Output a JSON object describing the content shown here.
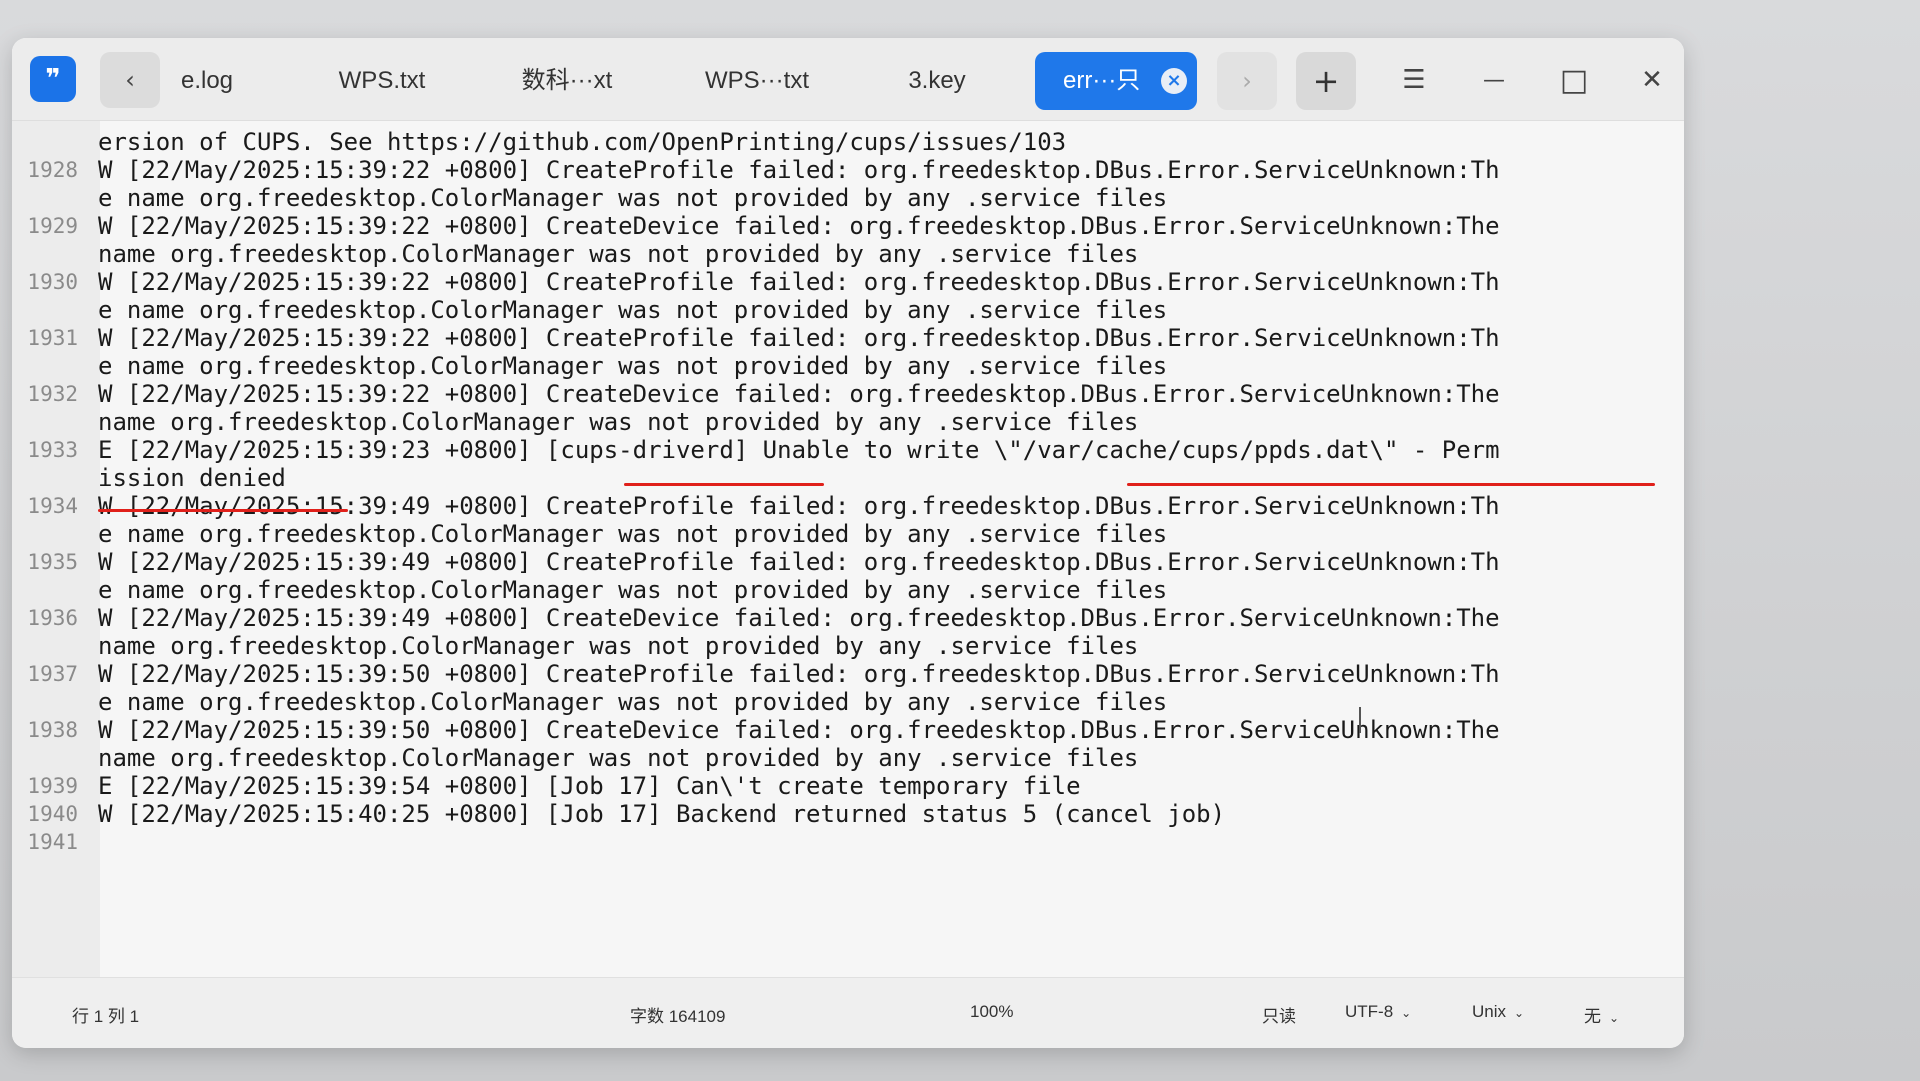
{
  "tabs": [
    {
      "label": "e.log"
    },
    {
      "label": "WPS.txt"
    },
    {
      "label": "数科···xt"
    },
    {
      "label": "WPS···txt"
    },
    {
      "label": "3.key"
    },
    {
      "label": "err···只",
      "active": true
    }
  ],
  "titlebar": {
    "app_icon": "quote-icon",
    "back_glyph": "‹",
    "forward_glyph": "›",
    "add_glyph": "+",
    "menu_glyph": "☰",
    "minimize_glyph": "—",
    "maximize_glyph": "□",
    "close_glyph": "✕",
    "tab_close_glyph": "×"
  },
  "editor": {
    "lines": [
      {
        "num": "",
        "text": "ersion of CUPS. See https://github.com/OpenPrinting/cups/issues/103"
      },
      {
        "num": "1928",
        "text": "W [22/May/2025:15:39:22 +0800] CreateProfile failed: org.freedesktop.DBus.Error.ServiceUnknown:Th"
      },
      {
        "num": "",
        "text": "e name org.freedesktop.ColorManager was not provided by any .service files"
      },
      {
        "num": "1929",
        "text": "W [22/May/2025:15:39:22 +0800] CreateDevice failed: org.freedesktop.DBus.Error.ServiceUnknown:The"
      },
      {
        "num": "",
        "text": "name org.freedesktop.ColorManager was not provided by any .service files"
      },
      {
        "num": "1930",
        "text": "W [22/May/2025:15:39:22 +0800] CreateProfile failed: org.freedesktop.DBus.Error.ServiceUnknown:Th"
      },
      {
        "num": "",
        "text": "e name org.freedesktop.ColorManager was not provided by any .service files"
      },
      {
        "num": "1931",
        "text": "W [22/May/2025:15:39:22 +0800] CreateProfile failed: org.freedesktop.DBus.Error.ServiceUnknown:Th"
      },
      {
        "num": "",
        "text": "e name org.freedesktop.ColorManager was not provided by any .service files"
      },
      {
        "num": "1932",
        "text": "W [22/May/2025:15:39:22 +0800] CreateDevice failed: org.freedesktop.DBus.Error.ServiceUnknown:The"
      },
      {
        "num": "",
        "text": "name org.freedesktop.ColorManager was not provided by any .service files"
      },
      {
        "num": "1933",
        "text": "E [22/May/2025:15:39:23 +0800] [cups-driverd] Unable to write \\\"/var/cache/cups/ppds.dat\\\" - Perm"
      },
      {
        "num": "",
        "text": "ission denied"
      },
      {
        "num": "1934",
        "text": "W [22/May/2025:15:39:49 +0800] CreateProfile failed: org.freedesktop.DBus.Error.ServiceUnknown:Th"
      },
      {
        "num": "",
        "text": "e name org.freedesktop.ColorManager was not provided by any .service files"
      },
      {
        "num": "1935",
        "text": "W [22/May/2025:15:39:49 +0800] CreateProfile failed: org.freedesktop.DBus.Error.ServiceUnknown:Th"
      },
      {
        "num": "",
        "text": "e name org.freedesktop.ColorManager was not provided by any .service files"
      },
      {
        "num": "1936",
        "text": "W [22/May/2025:15:39:49 +0800] CreateDevice failed: org.freedesktop.DBus.Error.ServiceUnknown:The"
      },
      {
        "num": "",
        "text": "name org.freedesktop.ColorManager was not provided by any .service files"
      },
      {
        "num": "1937",
        "text": "W [22/May/2025:15:39:50 +0800] CreateProfile failed: org.freedesktop.DBus.Error.ServiceUnknown:Th"
      },
      {
        "num": "",
        "text": "e name org.freedesktop.ColorManager was not provided by any .service files"
      },
      {
        "num": "1938",
        "text": "W [22/May/2025:15:39:50 +0800] CreateDevice failed: org.freedesktop.DBus.Error.ServiceUnknown:The"
      },
      {
        "num": "",
        "text": "name org.freedesktop.ColorManager was not provided by any .service files"
      },
      {
        "num": "1939",
        "text": "E [22/May/2025:15:39:54 +0800] [Job 17] Can\\'t create temporary file"
      },
      {
        "num": "1940",
        "text": "W [22/May/2025:15:40:25 +0800] [Job 17] Backend returned status 5 (cancel job)"
      },
      {
        "num": "1941",
        "text": ""
      }
    ],
    "annotation_color": "#e0201a"
  },
  "status": {
    "position": "行 1 列 1",
    "char_count": "字数 164109",
    "zoom": "100%",
    "readonly": "只读",
    "encoding": "UTF-8",
    "line_ending": "Unix",
    "highlight": "无",
    "dropdown_glyph": "⌄"
  },
  "colors": {
    "accent": "#1f78ea",
    "window_bg": "#f4f4f4",
    "gutter_bg": "#ececec",
    "annotation": "#e0201a"
  }
}
